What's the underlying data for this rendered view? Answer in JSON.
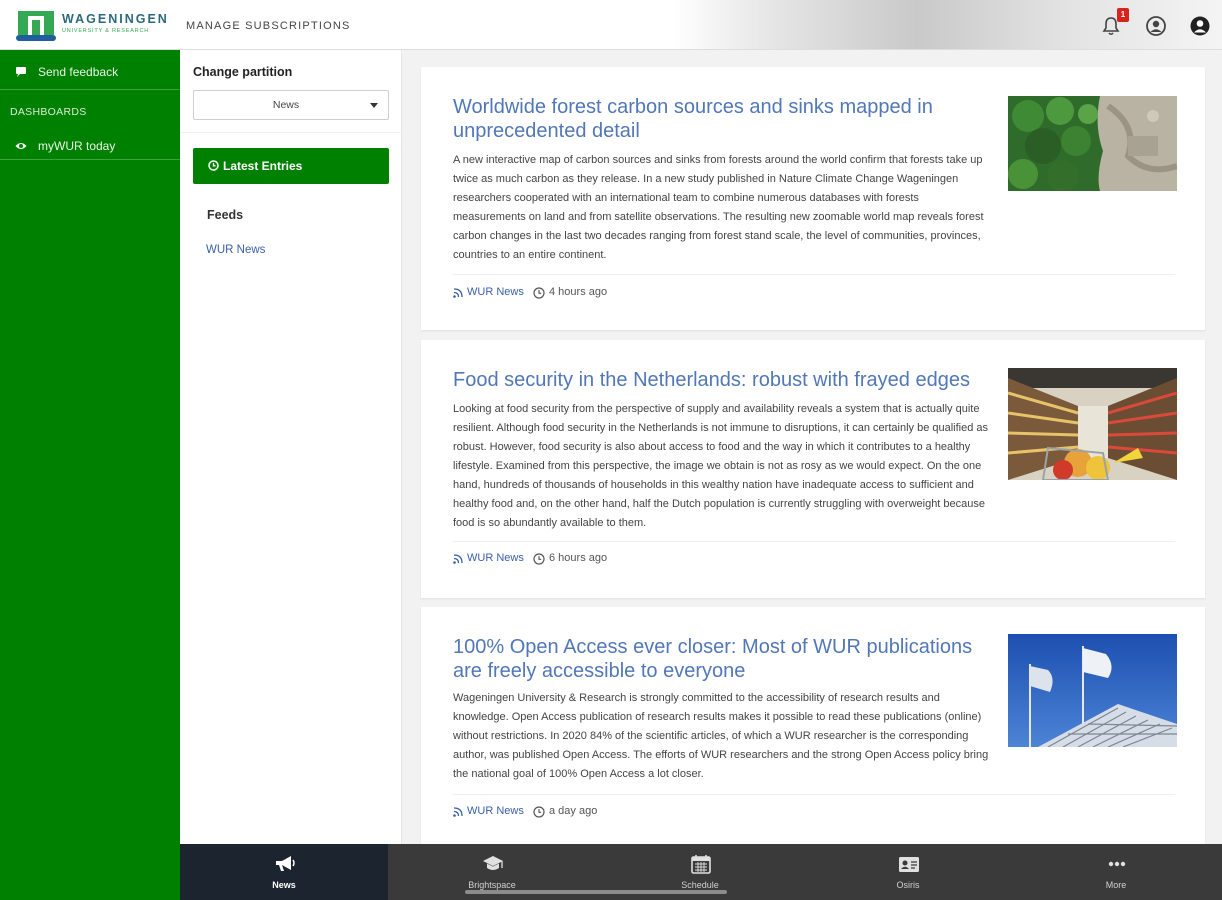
{
  "header": {
    "logo_name": "WAGENINGEN",
    "logo_sub": "UNIVERSITY & RESEARCH",
    "title": "MANAGE SUBSCRIPTIONS",
    "notification_count": "1",
    "icons": [
      "bell-icon",
      "account-circle-icon",
      "user-profile-icon"
    ]
  },
  "sidebar": {
    "feedback_label": "Send feedback",
    "section_label": "DASHBOARDS",
    "dashboard_label": "myWUR today"
  },
  "partition": {
    "label": "Change partition",
    "selected": "News",
    "latest_entries": "Latest Entries",
    "feeds_label": "Feeds",
    "feed_link": "WUR News"
  },
  "articles": [
    {
      "title": "Worldwide forest carbon sources and sinks mapped in unprecedented detail",
      "body": "A new interactive map of carbon sources and sinks from forests around the world confirm that forests take up twice as much carbon as they release. In a new study published in Nature Climate Change Wageningen researchers cooperated with an international team to combine numerous databases with forests measurements on land and from satellite observations. The resulting new zoomable world map reveals forest carbon changes in the last two decades ranging from forest stand scale, the level of communities, provinces, countries to an entire continent.",
      "source": "WUR News",
      "time": "4 hours ago",
      "image": "forest-aerial"
    },
    {
      "title": "Food security in the Netherlands: robust with frayed edges",
      "body": "Looking at food security from the perspective of supply and availability reveals a system that is actually quite resilient. Although food security in the Netherlands is not immune to disruptions, it can certainly be qualified as robust. However, food security is also about access to food and the way in which it contributes to a healthy lifestyle. Examined from this perspective, the image we obtain is not as rosy as we would expect. On the one hand, hundreds of thousands of households in this wealthy nation have inadequate access to sufficient and healthy food and, on the other hand, half the Dutch population is currently struggling with overweight because food is so abundantly available to them.",
      "source": "WUR News",
      "time": "6 hours ago",
      "image": "supermarket-aisle"
    },
    {
      "title": "100% Open Access ever closer: Most of WUR publications are freely accessible to everyone",
      "body": "Wageningen University & Research is strongly committed to the accessibility of research results and knowledge. Open Access publication of research results makes it possible to read these publications (online) without restrictions. In 2020 84% of the scientific articles, of which a WUR researcher is the corresponding author, was published Open Access. The efforts of WUR researchers and the strong Open Access policy bring the national goal of 100% Open Access a lot closer.",
      "source": "WUR News",
      "time": "a day ago",
      "image": "flags-building"
    }
  ],
  "bottom_nav": [
    {
      "label": "News",
      "icon": "megaphone-icon",
      "active": true
    },
    {
      "label": "Brightspace",
      "icon": "graduation-cap-icon",
      "active": false
    },
    {
      "label": "Schedule",
      "icon": "calendar-icon",
      "active": false
    },
    {
      "label": "Osiris",
      "icon": "id-card-icon",
      "active": false
    },
    {
      "label": "More",
      "icon": "more-dots-icon",
      "active": false
    }
  ],
  "colors": {
    "brand_green": "#008000",
    "link_blue": "#3a5fa8",
    "title_blue": "#5177b8",
    "nav_dark": "#3a3a3a",
    "nav_active": "#1c2430",
    "badge_red": "#d9231d"
  }
}
